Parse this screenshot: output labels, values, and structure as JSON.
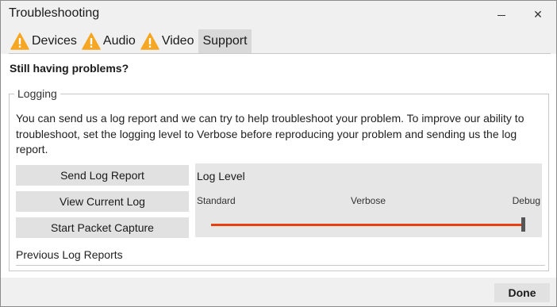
{
  "window": {
    "title": "Troubleshooting",
    "minimize_icon": "minimize-icon",
    "close_icon": "close-icon",
    "close_glyph": "✕"
  },
  "tabs": [
    {
      "label": "Devices",
      "icon": "warning-icon",
      "active": false
    },
    {
      "label": "Audio",
      "icon": "warning-icon",
      "active": false
    },
    {
      "label": "Video",
      "icon": "warning-icon",
      "active": false
    },
    {
      "label": "Support",
      "icon": "",
      "active": true
    }
  ],
  "content": {
    "heading": "Still having problems?",
    "logging": {
      "label": "Logging",
      "description": "You can send us a log report and we can try to help troubleshoot your problem. To improve our ability to troubleshoot, set the logging level to Verbose before reproducing your problem and sending us the log report.",
      "buttons": {
        "send": "Send Log Report",
        "view": "View Current Log",
        "capture": "Start Packet Capture"
      },
      "log_level": {
        "title": "Log Level",
        "ticks": [
          "Standard",
          "Verbose",
          "Debug"
        ],
        "value": "Debug",
        "level_index": 2,
        "track_color": "#e8400c"
      },
      "previous_reports": "Previous Log Reports"
    }
  },
  "footer": {
    "done": "Done"
  },
  "colors": {
    "warning": "#f5a623",
    "accent": "#e8400c"
  }
}
